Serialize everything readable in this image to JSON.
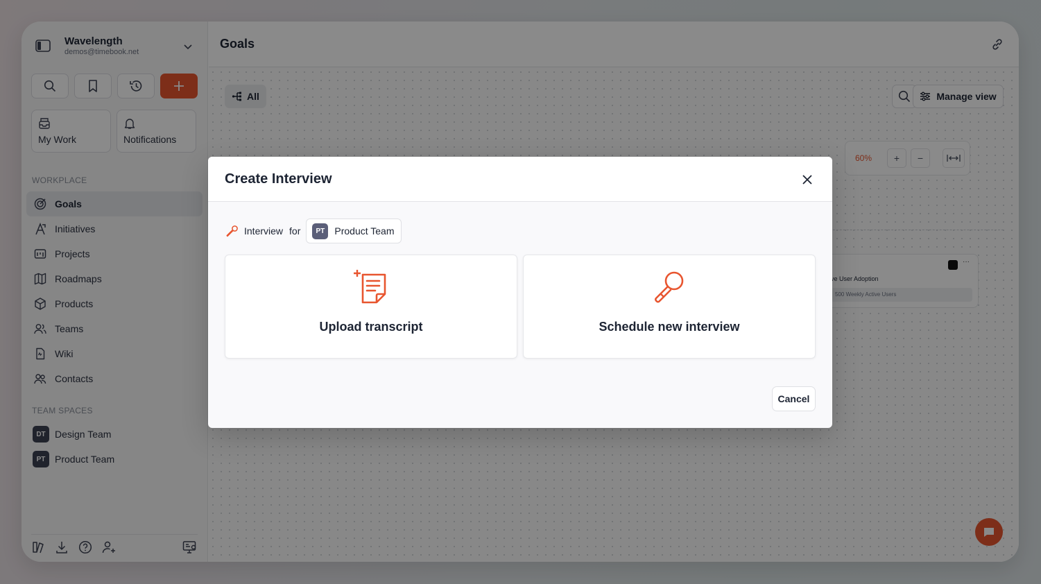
{
  "workspace": {
    "name": "Wavelength",
    "email": "demos@timebook.net"
  },
  "sidebar": {
    "quick_cards": [
      {
        "label": "My Work",
        "icon": "inbox-icon"
      },
      {
        "label": "Notifications",
        "icon": "bell-icon"
      }
    ],
    "workplace_label": "WORKPLACE",
    "items": [
      {
        "label": "Goals",
        "icon": "target-icon",
        "active": true
      },
      {
        "label": "Initiatives",
        "icon": "initiatives-icon"
      },
      {
        "label": "Projects",
        "icon": "projects-icon"
      },
      {
        "label": "Roadmaps",
        "icon": "map-icon"
      },
      {
        "label": "Products",
        "icon": "cube-icon"
      },
      {
        "label": "Teams",
        "icon": "team-icon"
      },
      {
        "label": "Wiki",
        "icon": "document-icon"
      },
      {
        "label": "Contacts",
        "icon": "contacts-icon"
      }
    ],
    "team_spaces_label": "TEAM SPACES",
    "team_spaces": [
      {
        "abbr": "DT",
        "label": "Design Team"
      },
      {
        "abbr": "PT",
        "label": "Product Team"
      }
    ]
  },
  "main": {
    "title": "Goals",
    "filter_label": "All",
    "manage_view_label": "Manage view",
    "zoom_level": "60%",
    "goal_card": {
      "title": "ve User Adoption",
      "key_result": "500 Weekly Active Users"
    }
  },
  "modal": {
    "title": "Create Interview",
    "interview_word": "Interview",
    "for_word": "for",
    "team": {
      "abbr": "PT",
      "name": "Product Team"
    },
    "options": [
      {
        "label": "Upload transcript",
        "icon": "transcript-icon"
      },
      {
        "label": "Schedule new interview",
        "icon": "microphone-icon"
      }
    ],
    "cancel_label": "Cancel"
  },
  "colors": {
    "accent": "#e8552f",
    "text": "#1d2433"
  }
}
